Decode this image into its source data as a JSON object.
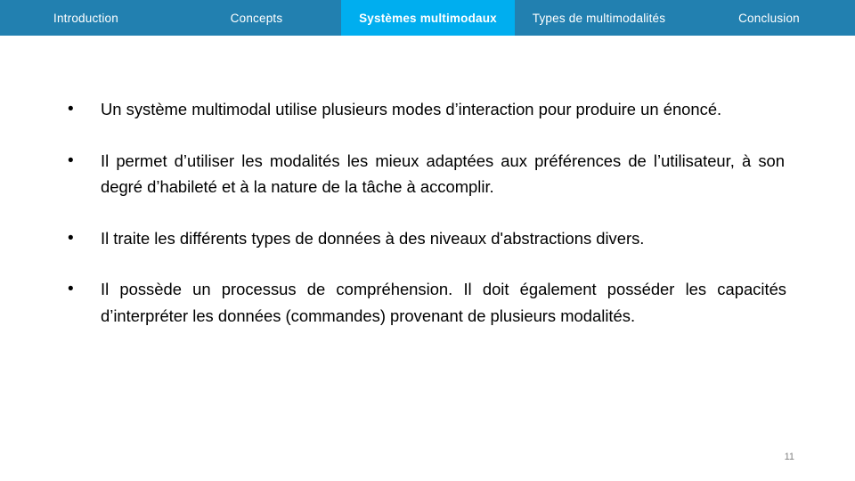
{
  "navbar": {
    "background_color": "#2280b0",
    "active_color": "#00aeef",
    "tabs": [
      {
        "label": "Introduction",
        "active": false
      },
      {
        "label": "Concepts",
        "active": false
      },
      {
        "label": "Systèmes multimodaux",
        "active": true
      },
      {
        "label": "Types de multimodalités",
        "active": false
      },
      {
        "label": "Conclusion",
        "active": false
      }
    ]
  },
  "content": {
    "bullet_marker": "•",
    "bullets": [
      "Un système multimodal utilise plusieurs modes d’interaction pour produire un énoncé.",
      "Il permet d’utiliser les modalités les mieux adaptées aux préférences de l’utilisateur, à son degré d’habileté et à la nature de la tâche à accomplir.",
      "Il traite les différents types de données à des niveaux d'abstractions divers.",
      "Il possède un processus de compréhension. Il doit également posséder les capacités d’interpréter les données (commandes) provenant de plusieurs modalités."
    ]
  },
  "footer": {
    "page_number": "11",
    "page_number_color": "#808080"
  }
}
